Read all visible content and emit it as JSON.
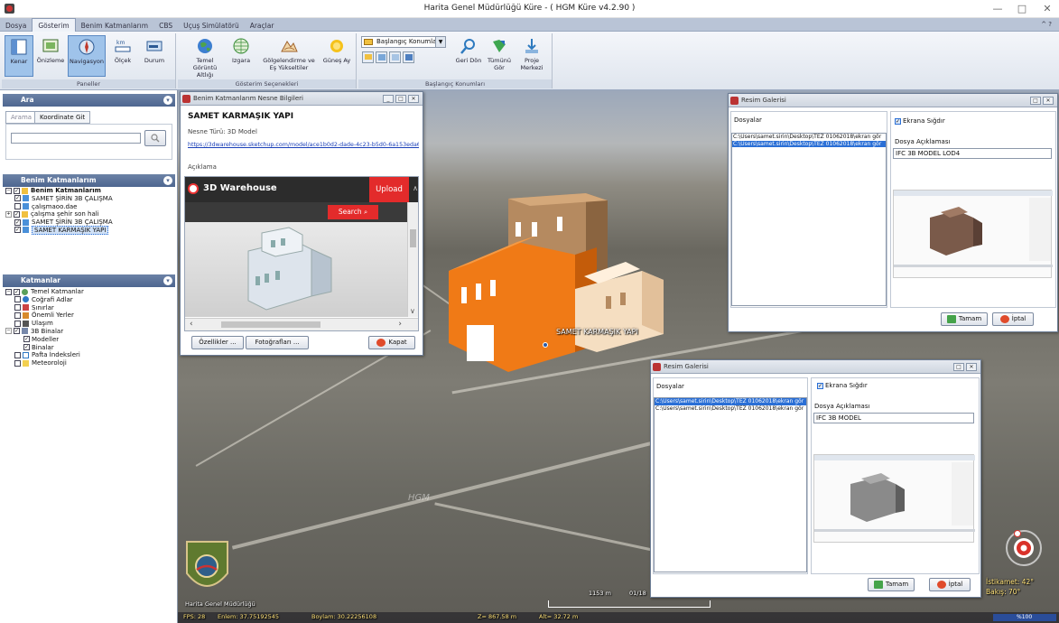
{
  "window": {
    "title": "Harita Genel Müdürlüğü Küre - ( HGM Küre v4.2.90 )",
    "min": "—",
    "max": "□",
    "close": "✕"
  },
  "menu": [
    "Dosya",
    "Gösterim",
    "Benim Katmanlarım",
    "CBS",
    "Uçuş Simülatörü",
    "Araçlar"
  ],
  "menu_right": "^ ?",
  "ribbon": {
    "panels": {
      "label": "Paneller",
      "buttons": [
        "Kenar",
        "Önizleme",
        "Navigasyon",
        "Ölçek",
        "Durum"
      ]
    },
    "display": {
      "label": "Gösterim Seçenekleri",
      "buttons": [
        "Temel Görüntü Altlığı",
        "Izgara",
        "Gölgelendirme ve Eş Yükseltiler",
        "Güneş Ay"
      ]
    },
    "start": {
      "label": "Başlangıç Konumları",
      "dropdown": "Başlangıç Konumları",
      "buttons": [
        "Geri Dön",
        "Tümünü Gör",
        "Proje Merkezi"
      ]
    }
  },
  "left": {
    "search": {
      "title": "Ara",
      "tabs": [
        "Arama",
        "Koordinate Git"
      ],
      "value": ""
    },
    "my_layers": {
      "title": "Benim Katmanlarım",
      "items": [
        "Benim Katmanlarım",
        "SAMET ŞİRİN 3B ÇALIŞMA",
        "çalışmaoo.dae",
        "çalışma şehir son hali",
        "SAMET ŞİRİN 3B ÇALIŞMA",
        "SAMET KARMAŞIK YAPI"
      ]
    },
    "layers": {
      "title": "Katmanlar",
      "items": [
        "Temel Katmanlar",
        "Coğrafi Adlar",
        "Sınırlar",
        "Önemli Yerler",
        "Ulaşım",
        "3B Binalar",
        "Modeller",
        "Binalar",
        "Pafta İndeksleri",
        "Meteoroloji"
      ]
    }
  },
  "info_window": {
    "title": "Benim Katmanlarım Nesne Bilgileri",
    "name": "SAMET KARMAŞIK YAPI",
    "type": "Nesne Türü: 3D Model",
    "link": "https://3dwarehouse.sketchup.com/model/ace1b0d2-dade-4c23-b5d0-6a153eda6281/S",
    "desc_label": "Açıklama",
    "warehouse": "3D Warehouse",
    "upload": "Upload",
    "search": "Search",
    "btn_props": "Özellikler ...",
    "btn_photos": "Fotoğrafları ...",
    "btn_close": "Kapat"
  },
  "gallery1": {
    "title": "Resim Galerisi",
    "files_label": "Dosyalar",
    "files": [
      "C:\\Users\\samet.sirin\\Desktop\\TEZ 01062018\\ekran gör",
      "C:\\Users\\samet.sirin\\Desktop\\TEZ 01062018\\ekran gör"
    ],
    "fit": "Ekrana Sığdır",
    "desc_label": "Dosya Açıklaması",
    "desc": "IFC 3B MODEL LOD4",
    "ok": "Tamam",
    "cancel": "İptal"
  },
  "gallery2": {
    "title": "Resim Galerisi",
    "files_label": "Dosyalar",
    "files": [
      "C:\\Users\\samet.sirin\\Desktop\\TEZ 01062018\\ekran gör",
      "C:\\Users\\samet.sirin\\Desktop\\TEZ 01062018\\ekran gör"
    ],
    "fit": "Ekrana Sığdır",
    "desc_label": "Dosya Açıklaması",
    "desc": "IFC 3B MODEL",
    "ok": "Tamam",
    "cancel": "İptal"
  },
  "map": {
    "building_label": "SAMET KARMAŞIK YAPI",
    "hgm": "HGM",
    "logo_text": "Harita Genel Müdürlüğü",
    "scale": "1153 m",
    "scale2": "01/18",
    "heading": "İstikamet: 42°",
    "tilt": "Bakış: 70°"
  },
  "status": {
    "fps": "FPS: 28",
    "lat": "Enlem: 37.75192545",
    "lon": "Boylam: 30.22256108",
    "z": "Z= 867.58 m",
    "alt": "Alt= 32.72 m",
    "progress": "%100"
  },
  "colors": {
    "accent": "#2a6fd6",
    "orange": "#f07a16",
    "tan": "#c89562",
    "cream": "#f3dcc0",
    "red": "#d9322a"
  }
}
